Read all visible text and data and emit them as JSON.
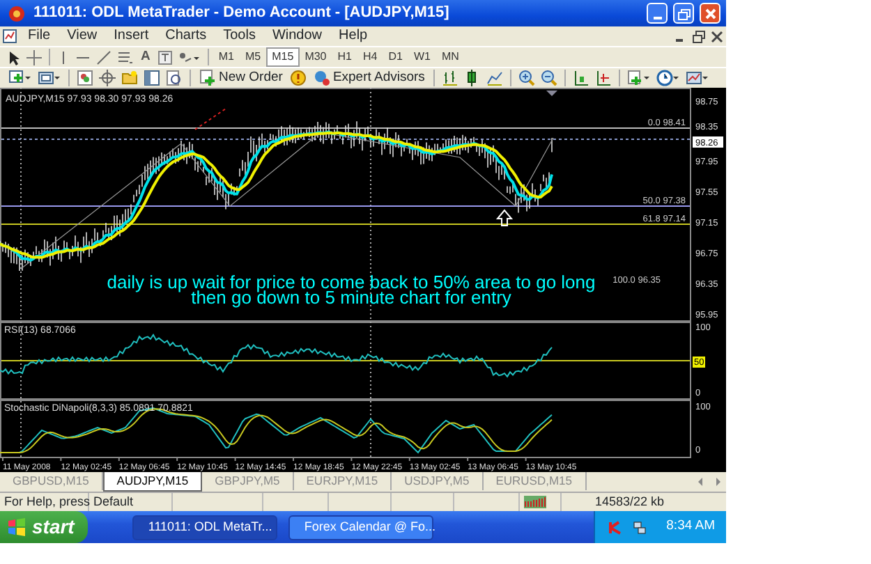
{
  "window": {
    "title": "111011: ODL MetaTrader - Demo Account - [AUDJPY,M15]"
  },
  "menu": [
    "File",
    "View",
    "Insert",
    "Charts",
    "Tools",
    "Window",
    "Help"
  ],
  "drawing_tools": {
    "text_tool": "A"
  },
  "timeframes": [
    {
      "label": "M1",
      "selected": false
    },
    {
      "label": "M5",
      "selected": false
    },
    {
      "label": "M15",
      "selected": true
    },
    {
      "label": "M30",
      "selected": false
    },
    {
      "label": "H1",
      "selected": false
    },
    {
      "label": "H4",
      "selected": false
    },
    {
      "label": "D1",
      "selected": false
    },
    {
      "label": "W1",
      "selected": false
    },
    {
      "label": "MN",
      "selected": false
    }
  ],
  "toolbar": {
    "new_order": "New Order",
    "expert_advisors": "Expert Advisors"
  },
  "chart": {
    "header": "AUDJPY,M15  97.93 98.30 97.93 98.26",
    "price_labels": [
      "98.75",
      "98.35",
      "97.95",
      "97.55",
      "97.15",
      "96.75",
      "96.35",
      "95.95"
    ],
    "current_price": "98.26",
    "fib_levels": [
      "0.0 98.41",
      "50.0 97.38",
      "61.8 97.14",
      "100.0 96.35"
    ],
    "annotation": [
      "daily is up wait for price to come back to 50% area to go long",
      "then go down to 5 minute chart for entry"
    ],
    "rsi": {
      "label": "RSI(13) 68.7066",
      "axis": [
        "100",
        "50",
        "0"
      ]
    },
    "stochastic": {
      "label": "Stochastic DiNapoli(8,3,3) 85.0891 70.8821",
      "axis": [
        "100",
        "0"
      ]
    },
    "time_labels": [
      "11 May 2008",
      "12 May 02:45",
      "12 May 06:45",
      "12 May 10:45",
      "12 May 14:45",
      "12 May 18:45",
      "12 May 22:45",
      "13 May 02:45",
      "13 May 06:45",
      "13 May 10:45"
    ]
  },
  "tabs": [
    {
      "label": "GBPUSD,M15",
      "selected": false
    },
    {
      "label": "AUDJPY,M15",
      "selected": true
    },
    {
      "label": "GBPJPY,M5",
      "selected": false
    },
    {
      "label": "EURJPY,M15",
      "selected": false
    },
    {
      "label": "USDJPY,M5",
      "selected": false
    },
    {
      "label": "EURUSD,M15",
      "selected": false
    }
  ],
  "status_bar": {
    "help": "For Help, press",
    "profile": "Default",
    "traffic": "14583/22 kb"
  },
  "taskbar": {
    "start": "start",
    "tasks": [
      {
        "label": "111011: ODL MetaTr...",
        "selected": true
      },
      {
        "label": "Forex Calendar @ Fo...",
        "selected": false
      }
    ],
    "clock": "8:34 AM"
  }
}
